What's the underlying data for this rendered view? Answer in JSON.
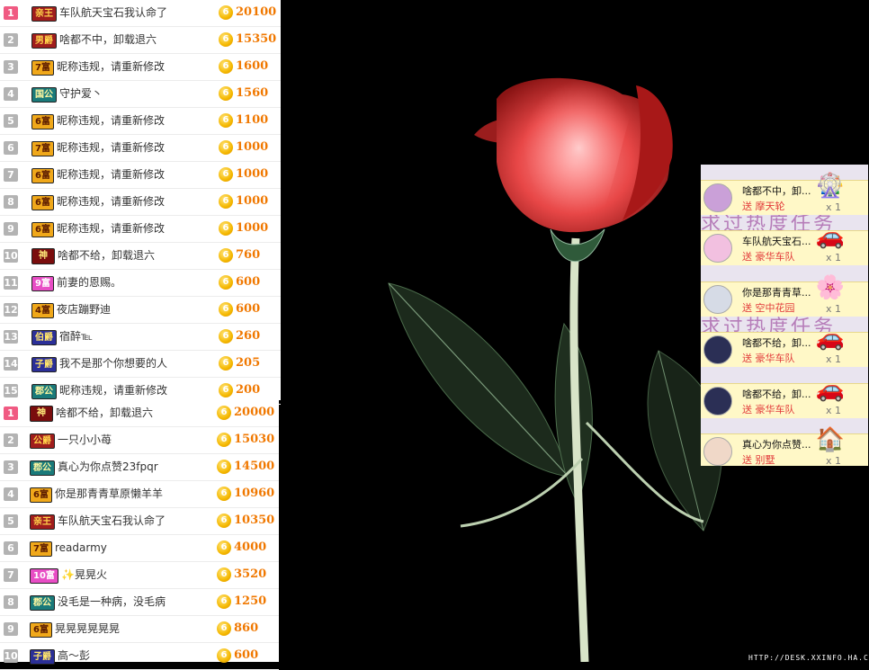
{
  "leaderboard_top": [
    {
      "rank": "1",
      "badge": "亲王",
      "badge_style": "b-king",
      "name": "车队航天宝石我认命了",
      "value": "20100",
      "top": true
    },
    {
      "rank": "2",
      "badge": "男爵",
      "badge_style": "b-king",
      "name": "啥都不中，卸载退六",
      "value": "15350"
    },
    {
      "rank": "3",
      "badge": "7富",
      "badge_style": "b-lux",
      "name": "昵称违规，请重新修改",
      "value": "1600"
    },
    {
      "rank": "4",
      "badge": "国公",
      "badge_style": "b-gong",
      "name": "守护爱丶",
      "value": "1560"
    },
    {
      "rank": "5",
      "badge": "6富",
      "badge_style": "b-lux",
      "name": "昵称违规，请重新修改",
      "value": "1100"
    },
    {
      "rank": "6",
      "badge": "7富",
      "badge_style": "b-lux",
      "name": "昵称违规，请重新修改",
      "value": "1000"
    },
    {
      "rank": "7",
      "badge": "6富",
      "badge_style": "b-lux",
      "name": "昵称违规，请重新修改",
      "value": "1000"
    },
    {
      "rank": "8",
      "badge": "6富",
      "badge_style": "b-lux",
      "name": "昵称违规，请重新修改",
      "value": "1000"
    },
    {
      "rank": "9",
      "badge": "6富",
      "badge_style": "b-lux",
      "name": "昵称违规，请重新修改",
      "value": "1000"
    },
    {
      "rank": "10",
      "badge": "神",
      "badge_style": "b-shen",
      "name": "啥都不给，卸载退六",
      "value": "760"
    },
    {
      "rank": "11",
      "badge": "9富",
      "badge_style": "b-pink",
      "name": "前妻的恩赐。",
      "value": "600"
    },
    {
      "rank": "12",
      "badge": "4富",
      "badge_style": "b-lux",
      "name": "夜店蹦野迪",
      "value": "600"
    },
    {
      "rank": "13",
      "badge": "伯爵",
      "badge_style": "b-nob",
      "name": "宿醉℡",
      "value": "260"
    },
    {
      "rank": "14",
      "badge": "子爵",
      "badge_style": "b-nob",
      "name": "我不是那个你想要的人",
      "value": "205"
    },
    {
      "rank": "15",
      "badge": "郡公",
      "badge_style": "b-gong",
      "name": "昵称违规，请重新修改",
      "value": "200"
    }
  ],
  "leaderboard_bottom": [
    {
      "rank": "1",
      "badge": "神",
      "badge_style": "b-shen",
      "name": "啥都不给，卸载退六",
      "value": "20000",
      "top": true
    },
    {
      "rank": "2",
      "badge": "公爵",
      "badge_style": "b-king",
      "name": "一只小小苺",
      "value": "15030"
    },
    {
      "rank": "3",
      "badge": "郡公",
      "badge_style": "b-gong",
      "name": "真心为你点赞23fpqr",
      "value": "14500"
    },
    {
      "rank": "4",
      "badge": "6富",
      "badge_style": "b-lux",
      "name": "你是那青青草原懒羊羊",
      "value": "10960"
    },
    {
      "rank": "5",
      "badge": "亲王",
      "badge_style": "b-king",
      "name": "车队航天宝石我认命了",
      "value": "10350"
    },
    {
      "rank": "6",
      "badge": "7富",
      "badge_style": "b-lux",
      "name": "readarmy",
      "value": "4000"
    },
    {
      "rank": "7",
      "badge": "10富",
      "badge_style": "b-pink",
      "name": "✨晃晃火",
      "value": "3520"
    },
    {
      "rank": "8",
      "badge": "郡公",
      "badge_style": "b-gong",
      "name": "没毛是一种病，没毛病",
      "value": "1250"
    },
    {
      "rank": "9",
      "badge": "6富",
      "badge_style": "b-lux",
      "name": "晃晃晃晃晃晃",
      "value": "860"
    },
    {
      "rank": "10",
      "badge": "子爵",
      "badge_style": "b-nob",
      "name": "高～彭",
      "value": "600"
    }
  ],
  "coin_label": "6",
  "gift_feed": {
    "banner": "求过热度任务",
    "items": [
      {
        "user": "啥都不中，卸...",
        "gift": "送 摩天轮",
        "count": "x 1",
        "icon": "ferris-wheel-icon"
      },
      {
        "user": "车队航天宝石...",
        "gift": "送 豪华车队",
        "count": "x 1",
        "icon": "car-icon"
      },
      {
        "user": "你是那青青草...",
        "gift": "送 空中花园",
        "count": "x 1",
        "icon": "garden-icon"
      },
      {
        "user": "啥都不给，卸...",
        "gift": "送 豪华车队",
        "count": "x 1",
        "icon": "car-icon"
      },
      {
        "user": "啥都不给，卸...",
        "gift": "送 豪华车队",
        "count": "x 1",
        "icon": "car-icon"
      },
      {
        "user": "真心为你点赞...",
        "gift": "送 别墅",
        "count": "x 1",
        "icon": "villa-icon"
      }
    ]
  },
  "watermark": "HTTP://DESK.XXINFO.HA.CN"
}
